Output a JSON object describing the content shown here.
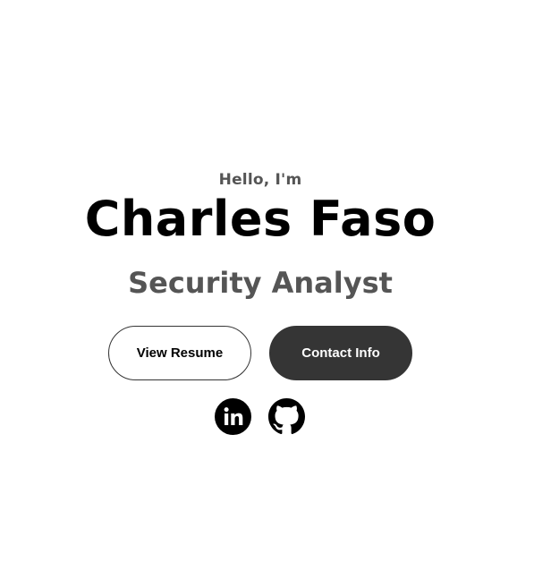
{
  "profile": {
    "greeting": "Hello, I'm",
    "name": "Charles Faso",
    "title": "Security Analyst"
  },
  "buttons": {
    "resume_label": "View Resume",
    "contact_label": "Contact Info"
  },
  "social": {
    "items": [
      {
        "icon": "linkedin-icon"
      },
      {
        "icon": "github-icon"
      }
    ]
  },
  "colors": {
    "accent_dark": "#353535",
    "muted_text": "#555555",
    "background": "#ffffff"
  }
}
